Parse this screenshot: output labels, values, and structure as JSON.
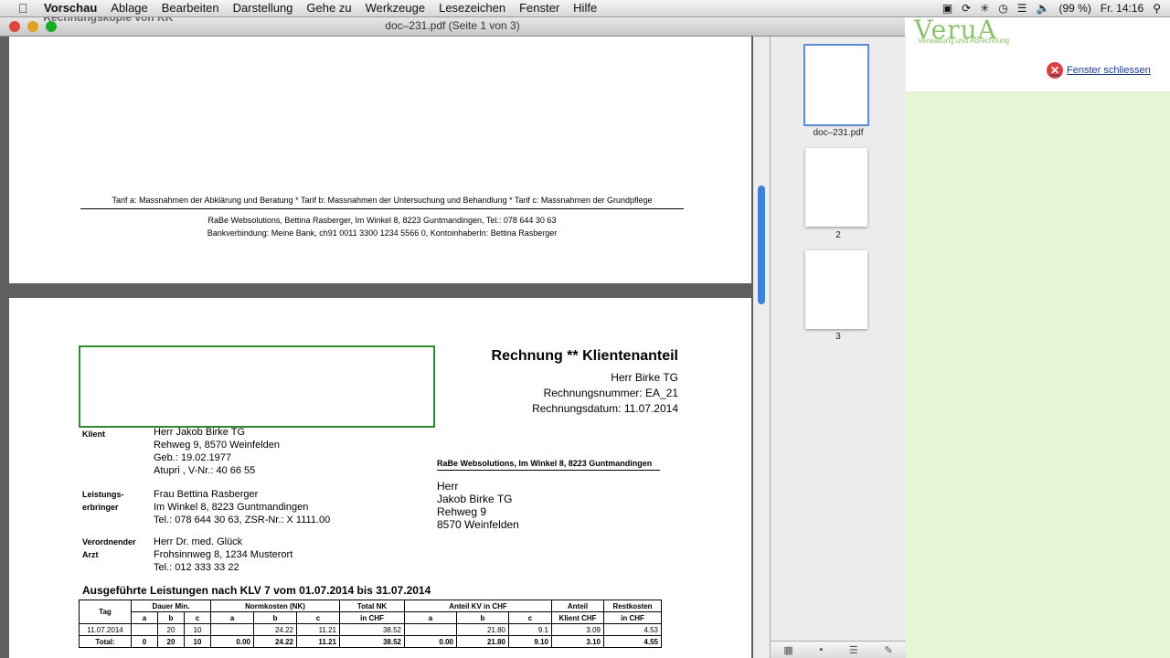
{
  "menubar": {
    "apple": "",
    "items": [
      "Vorschau",
      "Ablage",
      "Bearbeiten",
      "Darstellung",
      "Gehe zu",
      "Werkzeuge",
      "Lesezeichen",
      "Fenster",
      "Hilfe"
    ],
    "battery": "(99 %)",
    "clock": "Fr. 14:16"
  },
  "bg_app": {
    "logo": "VeruA",
    "logo_sub": "Verwaltung und Abrechnung",
    "close_label": "Fenster schliessen"
  },
  "window": {
    "title": "doc–231.pdf (Seite 1 von 3)",
    "ghost_text": "*** Rechnungskopie von KK ***"
  },
  "sidebar": {
    "thumbs": [
      {
        "label": "doc–231.pdf"
      },
      {
        "label": "2"
      },
      {
        "label": "3"
      }
    ]
  },
  "page1": {
    "tarif": "Tarif a: Massnahmen der Abklärung und Beratung * Tarif b: Massnahmen der Untersuchung und Behandlung * Tarif c: Massnahmen der Grundpflege",
    "footer1": "RaBe Websolutions, Bettina Rasberger, Im Winkel 8, 8223 Guntmandingen, Tel.: 078 644 30 63",
    "footer2": "Bankverbindung: Meine Bank, ch91 0011 3300 1234 5566 0, KontoinhaberIn: Bettina Rasberger"
  },
  "invoice": {
    "title": "Rechnung ** Klientenanteil",
    "recipient": "Herr Birke TG",
    "number": "Rechnungsnummer: EA_21",
    "date": "Rechnungsdatum: 11.07.2014",
    "client_label": "Klient",
    "client": [
      "Herr Jakob Birke TG",
      "Rehweg 9, 8570 Weinfelden",
      "Geb.: 19.02.1977",
      "Atupri , V-Nr.: 40 66 55"
    ],
    "provider_label": [
      "Leistungs-",
      "erbringer"
    ],
    "provider": [
      "Frau Bettina Rasberger",
      "Im Winkel 8, 8223 Guntmandingen",
      "Tel.: 078 644 30 63, ZSR-Nr.: X 1111.00"
    ],
    "doctor_label": [
      "Verordnender",
      "Arzt"
    ],
    "doctor": [
      "Herr Dr. med. Glück",
      "Frohsinnweg 8, 1234 Musterort",
      "Tel.: 012 333 33 22"
    ],
    "sender": "RaBe Websolutions, Im Winkel 8, 8223 Guntmandingen",
    "address": [
      "Herr",
      "Jakob Birke TG",
      "Rehweg 9",
      "8570 Weinfelden"
    ],
    "services_title": "Ausgeführte Leistungen nach KLV 7 vom 01.07.2014 bis 31.07.2014",
    "table": {
      "head1": [
        "Tag",
        "Dauer Min.",
        "Normkosten (NK)",
        "Total NK",
        "Anteil KV in CHF",
        "Anteil",
        "Restkosten"
      ],
      "head2": [
        "a",
        "b",
        "c",
        "a",
        "b",
        "c",
        "in CHF",
        "a",
        "b",
        "c",
        "Klient CHF",
        "in CHF"
      ],
      "rows": [
        [
          "11.07.2014",
          "",
          "20",
          "10",
          "",
          "24.22",
          "11.21",
          "38.52",
          "",
          "21.80",
          "9.1",
          "3.09",
          "4.53"
        ]
      ],
      "total": [
        "Total:",
        "0",
        "20",
        "10",
        "0.00",
        "24.22",
        "11.21",
        "38.52",
        "0.00",
        "21.80",
        "9.10",
        "3.10",
        "4.55"
      ]
    }
  }
}
